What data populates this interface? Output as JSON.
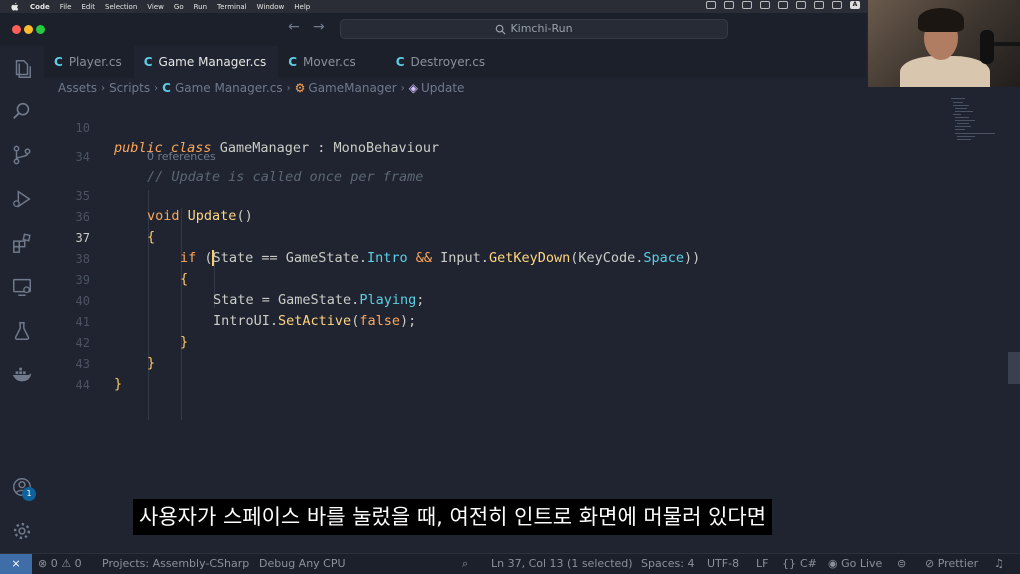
{
  "menubar": {
    "app": "Code",
    "items": [
      "File",
      "Edit",
      "Selection",
      "View",
      "Go",
      "Run",
      "Terminal",
      "Window",
      "Help"
    ],
    "input_indicator": "A"
  },
  "titlebar": {
    "search_text": "Kimchi-Run",
    "back_arrow": "←",
    "forward_arrow": "→"
  },
  "tabs": [
    {
      "icon": "C",
      "label": "Player.cs"
    },
    {
      "icon": "C",
      "label": "Game Manager.cs"
    },
    {
      "icon": "C",
      "label": "Mover.cs"
    },
    {
      "icon": "C",
      "label": "Destroyer.cs"
    }
  ],
  "breadcrumb": {
    "items": [
      "Assets",
      "Scripts",
      "Game Manager.cs",
      "GameManager",
      "Update"
    ]
  },
  "activity": {
    "icons": [
      "files-icon",
      "search-icon",
      "source-control-icon",
      "run-debug-icon",
      "extensions-icon",
      "remote-explorer-icon",
      "testing-icon",
      "docker-icon",
      "account-icon",
      "settings-gear-icon"
    ],
    "badge": "1"
  },
  "editor": {
    "line_numbers": [
      "10",
      "34",
      "35",
      "36",
      "37",
      "38",
      "39",
      "40",
      "41",
      "42",
      "43",
      "44"
    ],
    "current_line": "37",
    "codelens": "0 references",
    "code": {
      "l10": {
        "kw1": "public",
        "kw2": "class",
        "name": "GameManager",
        "colon": " : ",
        "base": "MonoBehaviour"
      },
      "l34": {
        "comment": "// Update is called once per frame"
      },
      "l35": {
        "kw": "void",
        "name": "Update",
        "paren": "()"
      },
      "l36": {
        "brace": "{"
      },
      "l37": {
        "kw": "if",
        "open": "(",
        "s_char": "S",
        "rest1": "tate == GameState.",
        "intro": "Intro",
        "and": " && ",
        "input": "Input.",
        "getkey": "GetKeyDown",
        "open2": "(",
        "keycode": "KeyCode.",
        "space": "Space",
        "close": "))"
      },
      "l38": {
        "brace": "{"
      },
      "l39": {
        "lhs": "State = GameState.",
        "playing": "Playing",
        "semi": ";"
      },
      "l40": {
        "obj": "IntroUI.",
        "method": "SetActive",
        "open": "(",
        "lit": "false",
        "close": ");"
      },
      "l41": {
        "brace": "}"
      },
      "l42": {
        "brace": "}"
      },
      "l43": {
        "brace": "}"
      }
    }
  },
  "subtitle": "사용자가 스페이스 바를 눌렀을 때, 여전히 인트로 화면에 머물러 있다면",
  "statusbar": {
    "errors": "0",
    "warnings": "0",
    "project": "Projects: Assembly-CSharp",
    "config": "Debug Any CPU",
    "position": "Ln 37, Col 13 (1 selected)",
    "spaces": "Spaces: 4",
    "encoding": "UTF-8",
    "eol": "LF",
    "language": "C#",
    "golive": "Go Live",
    "prettier": "Prettier"
  },
  "colors": {
    "background": "#1f2430",
    "keyword": "#ffa759",
    "function": "#ffd580",
    "member": "#5ccfe6",
    "comment": "#5c6773",
    "remote": "#3e6da8"
  }
}
